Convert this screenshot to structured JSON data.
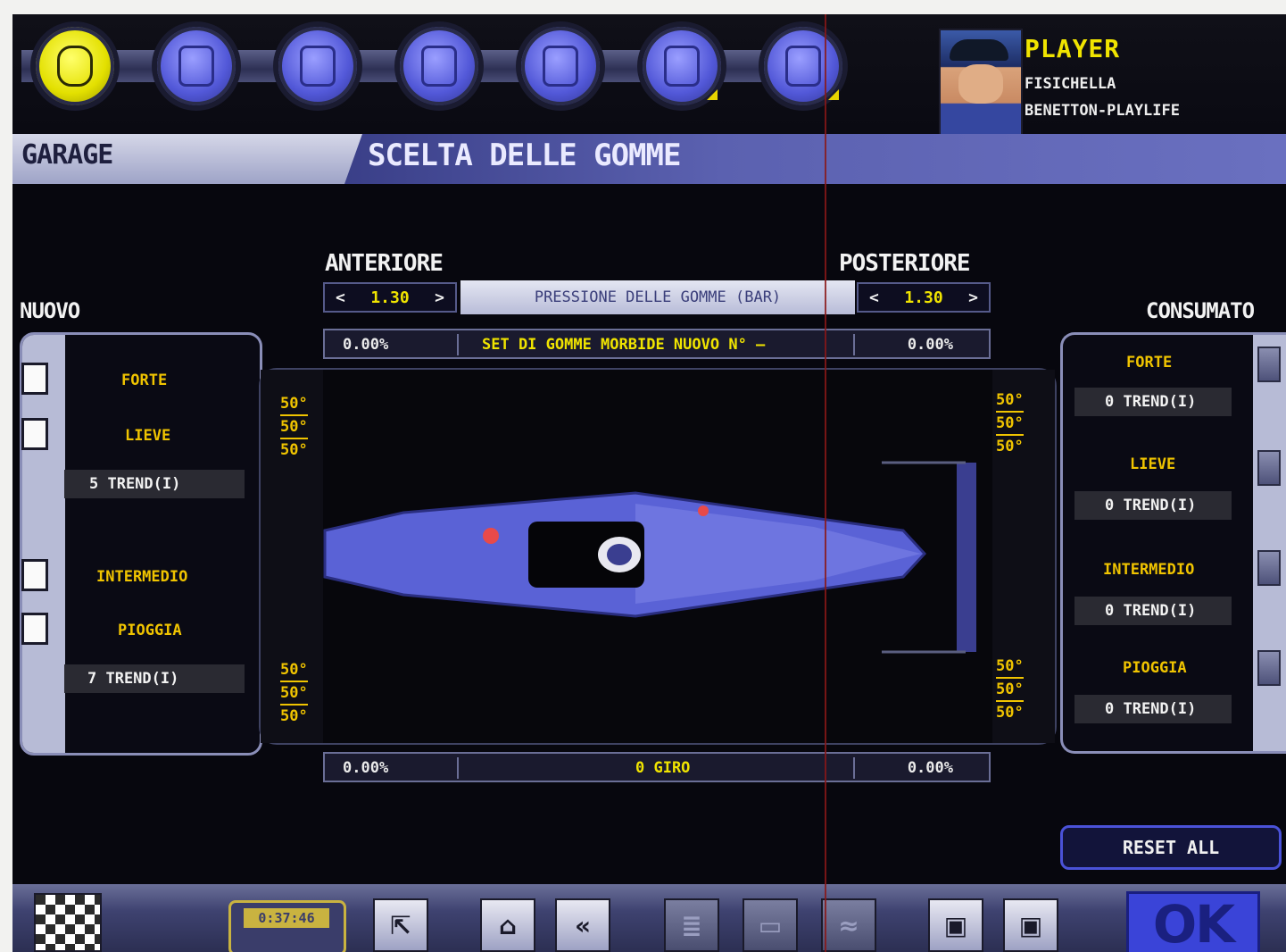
{
  "tabs": [
    {
      "name": "tab-tyres",
      "active": true,
      "corner": false
    },
    {
      "name": "tab-fuel",
      "active": false,
      "corner": false
    },
    {
      "name": "tab-balance",
      "active": false,
      "corner": false
    },
    {
      "name": "tab-engine",
      "active": false,
      "corner": false
    },
    {
      "name": "tab-brakes",
      "active": false,
      "corner": false
    },
    {
      "name": "tab-aero",
      "active": false,
      "corner": true
    },
    {
      "name": "tab-telemetry",
      "active": false,
      "corner": true
    }
  ],
  "player": {
    "label": "PLAYER",
    "driver": "FISICHELLA",
    "team": "BENETTON-PLAYLIFE"
  },
  "header": {
    "section": "GARAGE",
    "title": "SCELTA DELLE GOMME"
  },
  "front": {
    "label": "ANTERIORE",
    "pressure": "1.30",
    "prev": "<",
    "next": ">"
  },
  "rear": {
    "label": "POSTERIORE",
    "pressure": "1.30",
    "prev": "<",
    "next": ">"
  },
  "pressure_label": "PRESSIONE DELLE GOMME (BAR)",
  "top_bar": {
    "left": "0.00%",
    "middle": "SET DI GOMME MORBIDE NUOVO   N° —",
    "right": "0.00%"
  },
  "bottom_bar": {
    "left": "0.00%",
    "middle": "0 GIRO",
    "right": "0.00%"
  },
  "new_panel": {
    "title": "NUOVO",
    "forte": "FORTE",
    "lieve": "LIEVE",
    "trend1": "5 TREND(I)",
    "intermedio": "INTERMEDIO",
    "pioggia": "PIOGGIA",
    "trend2": "7 TREND(I)"
  },
  "used_panel": {
    "title": "CONSUMATO",
    "items": [
      {
        "label": "FORTE",
        "trend": "0 TREND(I)"
      },
      {
        "label": "LIEVE",
        "trend": "0 TREND(I)"
      },
      {
        "label": "INTERMEDIO",
        "trend": "0 TREND(I)"
      },
      {
        "label": "PIOGGIA",
        "trend": "0 TREND(I)"
      }
    ]
  },
  "tires": {
    "front_left": [
      "50°",
      "50°",
      "50°"
    ],
    "front_right": [
      "50°",
      "50°",
      "50°"
    ],
    "rear_left": [
      "50°",
      "50°",
      "50°"
    ],
    "rear_right": [
      "50°",
      "50°",
      "50°"
    ]
  },
  "reset_label": "RESET ALL",
  "clock": "0:37:46",
  "ok_label": "OK"
}
